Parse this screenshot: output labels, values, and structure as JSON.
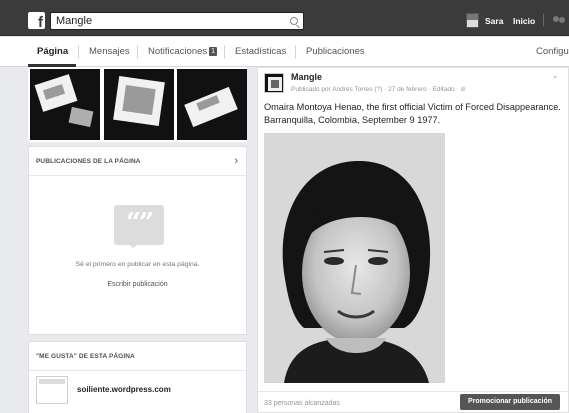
{
  "header": {
    "logo_letter": "f",
    "search_value": "Mangle",
    "search_icon": "search-icon",
    "user_name": "Sara",
    "home_label": "Inicio",
    "friends_icon": "friends-icon"
  },
  "tabs": [
    {
      "label": "Página",
      "active": true
    },
    {
      "label": "Mensajes",
      "active": false
    },
    {
      "label": "Notificaciones",
      "active": false,
      "badge": "1"
    },
    {
      "label": "Estadísticas",
      "active": false
    },
    {
      "label": "Publicaciones",
      "active": false
    },
    {
      "label": "Configu",
      "active": false
    }
  ],
  "left": {
    "page_posts_title": "PUBLICACIONES DE LA PÁGINA",
    "chevron_icon": "chevron-right-icon",
    "empty_icon": "quote-bubble-icon",
    "empty_icon_glyph": "“”",
    "empty_text": "Sé el primero en publicar en esta página.",
    "write_post": "Escribir publicación",
    "likes_title": "\"ME GUSTA\" DE ESTA PÁGINA",
    "liked_site": "soiliente.wordpress.com"
  },
  "post": {
    "author": "Mangle",
    "meta": "Publicado por Andrés Torres (?) · 27 de febrero · Editado · ⊘",
    "menu_icon": "chevron-down-icon",
    "text": "Omaira Montoya Henao, the first official Victim of Forced Disappearance. Barranquilla, Colombia, September 9 1977.",
    "reach": "33 personas alcanzadas",
    "promote_label": "Promocionar publicación"
  }
}
